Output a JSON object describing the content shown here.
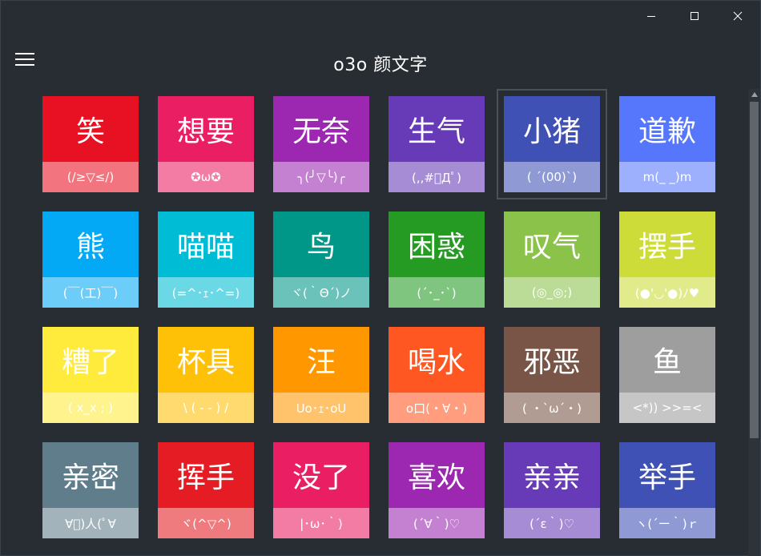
{
  "app": {
    "title": "o3o 颜文字"
  },
  "window_controls": {
    "minimize_icon": "minimize-icon",
    "maximize_icon": "maximize-icon",
    "close_icon": "close-icon"
  },
  "header": {
    "menu_icon": "hamburger-menu-icon"
  },
  "tiles": [
    {
      "label": "笑",
      "kaomoji": "(/≥▽≤/)",
      "color": "#e81123"
    },
    {
      "label": "想要",
      "kaomoji": "✪ω✪",
      "color": "#e91e63"
    },
    {
      "label": "无奈",
      "kaomoji": "╮(╯▽╰)╭",
      "color": "#9c27b0"
    },
    {
      "label": "生气",
      "kaomoji": "(,,#ﾟДﾟ)",
      "color": "#673ab7"
    },
    {
      "label": "小猪",
      "kaomoji": "( ´(00)ˋ)",
      "color": "#3f51b5"
    },
    {
      "label": "道歉",
      "kaomoji": "m(_ _)m",
      "color": "#5677fc"
    },
    {
      "label": "熊",
      "kaomoji": "(￣(工)￣)",
      "color": "#03a9f4"
    },
    {
      "label": "喵喵",
      "kaomoji": "(=^･ｪ･^=)",
      "color": "#00bcd4"
    },
    {
      "label": "鸟",
      "kaomoji": "ヾ(｀Θ´)ノ",
      "color": "#009688"
    },
    {
      "label": "困惑",
      "kaomoji": "(´･_･`)",
      "color": "#259b24"
    },
    {
      "label": "叹气",
      "kaomoji": "(◎_◎;)",
      "color": "#8bc34a"
    },
    {
      "label": "摆手",
      "kaomoji": "(●'◡'●)ﾉ♥",
      "color": "#cddc39"
    },
    {
      "label": "糟了",
      "kaomoji": "( x_x ; )",
      "color": "#ffeb3b"
    },
    {
      "label": "杯具",
      "kaomoji": "\\ ( - - ) /",
      "color": "#ffc107"
    },
    {
      "label": "汪",
      "kaomoji": "Uo･ｪ･oU",
      "color": "#ff9800"
    },
    {
      "label": "喝水",
      "kaomoji": "o口(・∀・)",
      "color": "#ff5722"
    },
    {
      "label": "邪恶",
      "kaomoji": "( ・ˋωˊ・)",
      "color": "#795548"
    },
    {
      "label": "鱼",
      "kaomoji": "<*)) >>=<",
      "color": "#9e9e9e"
    },
    {
      "label": "亲密",
      "kaomoji": "∀ﾟ)人(ﾟ∀",
      "color": "#607d8b"
    },
    {
      "label": "挥手",
      "kaomoji": "ヾ(^▽^)",
      "color": "#e51c23"
    },
    {
      "label": "没了",
      "kaomoji": "|･ω･｀)",
      "color": "#e91e63"
    },
    {
      "label": "喜欢",
      "kaomoji": "(´∀｀)♡",
      "color": "#9c27b0"
    },
    {
      "label": "亲亲",
      "kaomoji": "(´ε｀)♡",
      "color": "#673ab7"
    },
    {
      "label": "举手",
      "kaomoji": "ヽ(´ー｀)ｒ",
      "color": "#3f51b5"
    }
  ],
  "colors": {
    "background": "#272d33",
    "focus_ring": "#4a5157",
    "scroll_thumb": "#5f656a"
  }
}
